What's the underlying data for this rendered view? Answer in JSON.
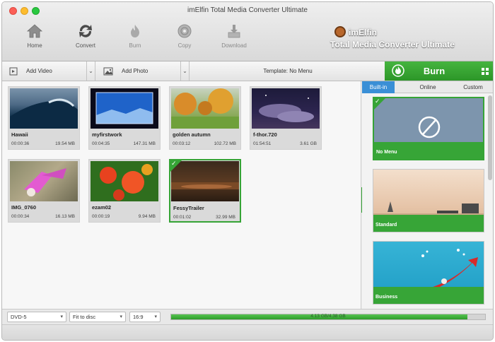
{
  "window": {
    "title": "imElfin Total Media Converter Ultimate"
  },
  "toolbar": {
    "home": "Home",
    "convert": "Convert",
    "burn": "Burn",
    "copy": "Copy",
    "download": "Download"
  },
  "brand": {
    "name": "imElfin",
    "subtitle": "Total Media Converter Ultimate"
  },
  "subbar": {
    "add_video": "Add Video",
    "add_photo": "Add Photo",
    "template": "Template: No Menu",
    "burn": "Burn"
  },
  "media": [
    {
      "name": "Hawaii",
      "duration": "00:00:36",
      "size": "19.54 MB"
    },
    {
      "name": "myfirstwork",
      "duration": "00:04:35",
      "size": "147.31 MB"
    },
    {
      "name": "golden autumn",
      "duration": "00:03:12",
      "size": "102.72 MB"
    },
    {
      "name": "f-thor.720",
      "duration": "01:54:51",
      "size": "3.61 GB"
    },
    {
      "name": "IMG_0760",
      "duration": "00:00:34",
      "size": "16.13 MB"
    },
    {
      "name": "ezam02",
      "duration": "00:00:19",
      "size": "9.94 MB"
    },
    {
      "name": "FessyTrailer",
      "duration": "00:01:02",
      "size": "32.99 MB"
    }
  ],
  "panel": {
    "tabs": [
      "Built-in",
      "Online",
      "Custom"
    ],
    "templates": [
      {
        "name": "No Menu"
      },
      {
        "name": "Standard"
      },
      {
        "name": "Business"
      }
    ]
  },
  "bottom": {
    "disc_type": "DVD-5",
    "fit_mode": "Fit to disc",
    "aspect": "16:9",
    "capacity": "4.13 GB/4.38 GB",
    "capacity_fraction": 0.943
  },
  "colors": {
    "accent_green": "#36a436",
    "tab_blue": "#3a8fd6"
  }
}
